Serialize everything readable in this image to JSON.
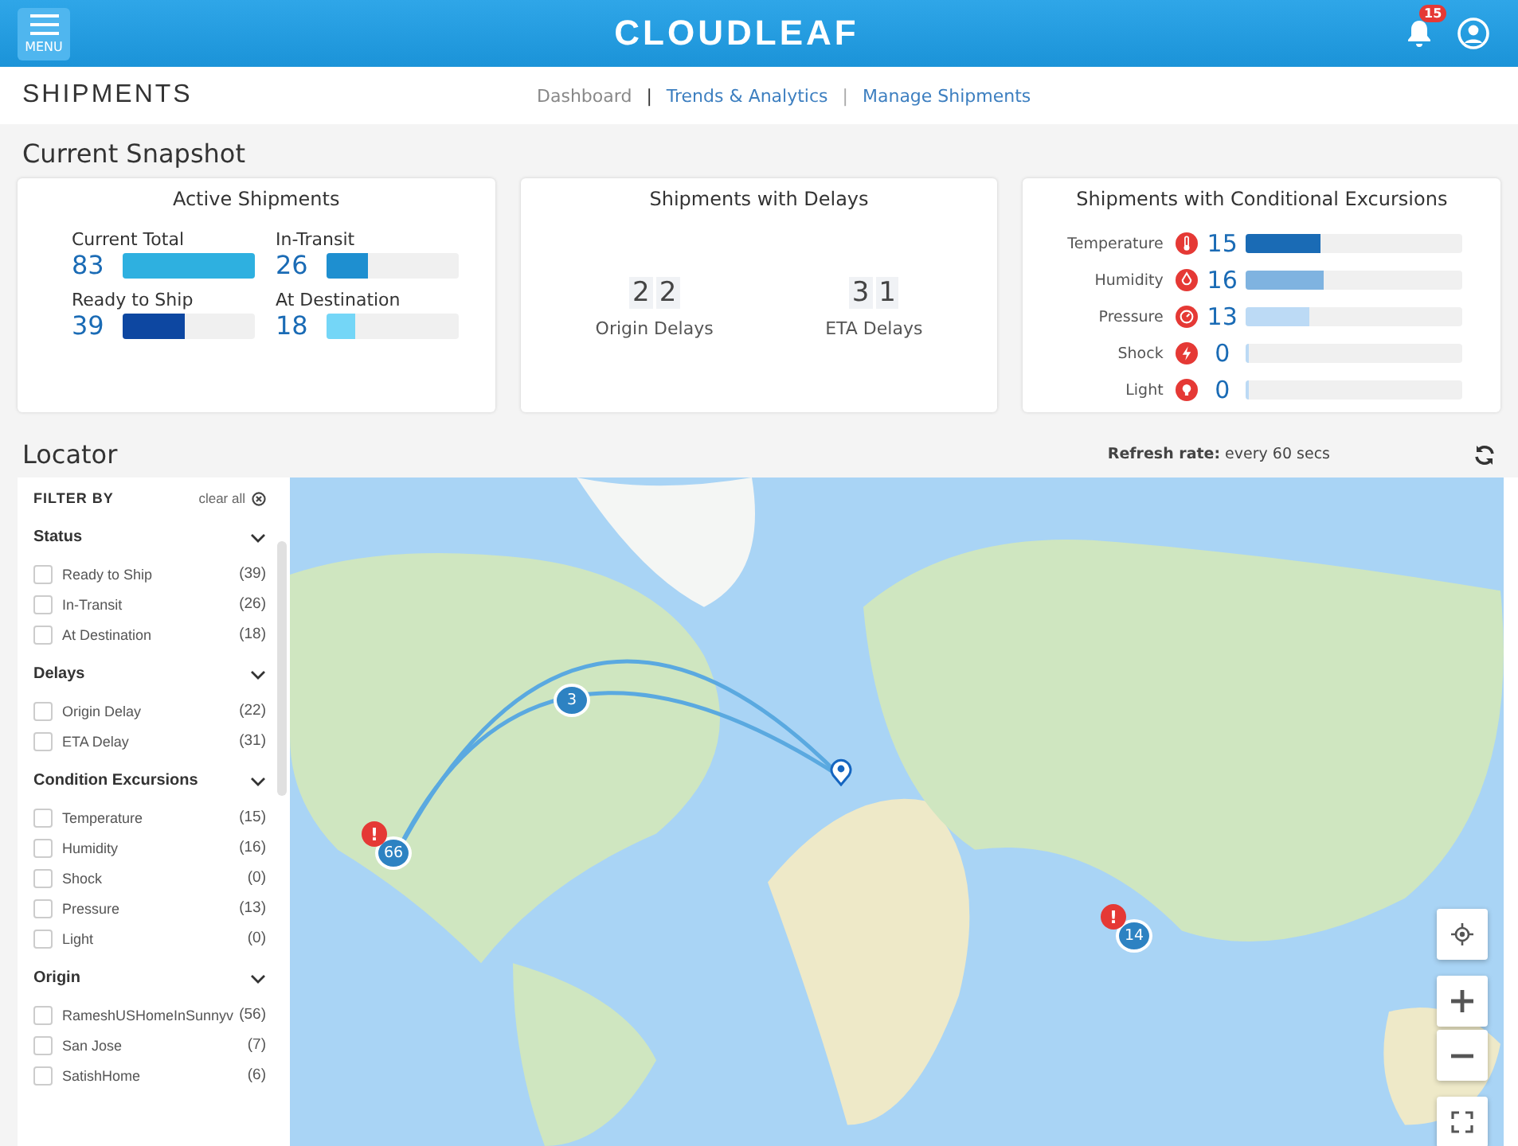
{
  "header": {
    "menu_label": "MENU",
    "logo": "CLOUDLEAF",
    "notification_count": "15"
  },
  "subheader": {
    "title": "SHIPMENTS",
    "links": [
      {
        "label": "Dashboard",
        "selected": true
      },
      {
        "label": "Trends & Analytics",
        "selected": false
      },
      {
        "label": "Manage Shipments",
        "selected": false
      }
    ],
    "separators": [
      "|",
      "|"
    ]
  },
  "snapshot": {
    "title": "Current Snapshot",
    "active": {
      "title": "Active Shipments",
      "items": [
        {
          "label": "Current Total",
          "value": "83",
          "level": 1.0,
          "color": "#2eb0e0"
        },
        {
          "label": "In-Transit",
          "value": "26",
          "level": 0.31,
          "color": "#1e8fd0"
        },
        {
          "label": "Ready to Ship",
          "value": "39",
          "level": 0.47,
          "color": "#0d47a1"
        },
        {
          "label": "At Destination",
          "value": "18",
          "level": 0.22,
          "color": "#74d6f7"
        }
      ]
    },
    "delays": {
      "title": "Shipments with Delays",
      "items": [
        {
          "digits": [
            "2",
            "2"
          ],
          "label": "Origin Delays"
        },
        {
          "digits": [
            "3",
            "1"
          ],
          "label": "ETA Delays"
        }
      ]
    },
    "excursions": {
      "title": "Shipments with Conditional Excursions",
      "items": [
        {
          "kind": "temperature",
          "label": "Temperature",
          "value": "15",
          "level": 0.34,
          "color": "#1a6bb5"
        },
        {
          "kind": "humidity",
          "label": "Humidity",
          "value": "16",
          "level": 0.36,
          "color": "#7fb3e0"
        },
        {
          "kind": "pressure",
          "label": "Pressure",
          "value": "13",
          "level": 0.29,
          "color": "#bcdaf5"
        },
        {
          "kind": "shock",
          "label": "Shock",
          "value": "0",
          "level": 0
        },
        {
          "kind": "light",
          "label": "Light",
          "value": "0",
          "level": 0
        }
      ]
    }
  },
  "locator": {
    "title": "Locator",
    "refresh_label": "Refresh rate:",
    "refresh_value": "every 60 secs",
    "filter": {
      "title": "FILTER BY",
      "clear_label": "clear all",
      "groups": [
        {
          "title": "Status",
          "expanded": true,
          "items": [
            {
              "label": "Ready to Ship",
              "count": "(39)",
              "checked": false
            },
            {
              "label": "In-Transit",
              "count": "(26)",
              "checked": false
            },
            {
              "label": "At Destination",
              "count": "(18)",
              "checked": false
            }
          ]
        },
        {
          "title": "Delays",
          "expanded": true,
          "items": [
            {
              "label": "Origin Delay",
              "count": "(22)",
              "checked": false
            },
            {
              "label": "ETA Delay",
              "count": "(31)",
              "checked": false
            }
          ]
        },
        {
          "title": "Condition Excursions",
          "expanded": true,
          "items": [
            {
              "label": "Temperature",
              "count": "(15)",
              "checked": false
            },
            {
              "label": "Humidity",
              "count": "(16)",
              "checked": false
            },
            {
              "label": "Shock",
              "count": "(0)",
              "checked": false
            },
            {
              "label": "Pressure",
              "count": "(13)",
              "checked": false
            },
            {
              "label": "Light",
              "count": "(0)",
              "checked": false
            }
          ]
        },
        {
          "title": "Origin",
          "expanded": true,
          "items": [
            {
              "label": "RameshUSHomeInSunnyv",
              "count": "(56)",
              "checked": false
            },
            {
              "label": "San Jose",
              "count": "(7)",
              "checked": false
            },
            {
              "label": "SatishHome",
              "count": "(6)",
              "checked": false
            }
          ]
        }
      ]
    },
    "markers": [
      {
        "kind": "cluster",
        "label": "66"
      },
      {
        "kind": "cluster",
        "label": "3"
      },
      {
        "kind": "cluster",
        "label": "14"
      },
      {
        "kind": "alert",
        "label": "!"
      },
      {
        "kind": "alert",
        "label": "!"
      },
      {
        "kind": "pin"
      }
    ]
  }
}
